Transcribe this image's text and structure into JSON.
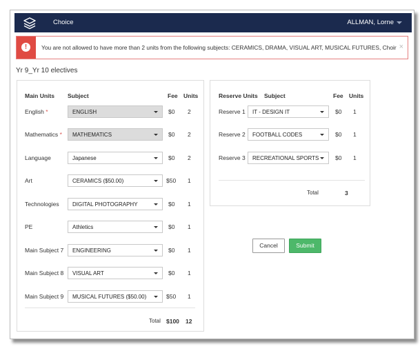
{
  "header": {
    "app_title": "Choice",
    "user_name": "ALLMAN, Lorne"
  },
  "alert": {
    "message": "You are not allowed to have more than 2 units from the following subjects: CERAMICS, DRAMA, VISUAL ART, MUSICAL FUTURES, Choir",
    "close": "×",
    "icon": "!"
  },
  "section_title": "Yr 9_Yr 10 electives",
  "main_units": {
    "headers": {
      "unit": "Main Units",
      "subject": "Subject",
      "fee": "Fee",
      "units": "Units"
    },
    "rows": [
      {
        "label": "English",
        "required": true,
        "subject": "ENGLISH",
        "disabled": true,
        "fee": "$0",
        "units": "2"
      },
      {
        "label": "Mathematics",
        "required": true,
        "subject": "MATHEMATICS",
        "disabled": true,
        "fee": "$0",
        "units": "2"
      },
      {
        "label": "Language",
        "required": false,
        "subject": "Japanese",
        "disabled": false,
        "fee": "$0",
        "units": "2"
      },
      {
        "label": "Art",
        "required": false,
        "subject": "CERAMICS ($50.00)",
        "disabled": false,
        "fee": "$50",
        "units": "1"
      },
      {
        "label": "Technologies",
        "required": false,
        "subject": "DIGITAL PHOTOGRAPHY",
        "disabled": false,
        "fee": "$0",
        "units": "1"
      },
      {
        "label": "PE",
        "required": false,
        "subject": "Athletics",
        "disabled": false,
        "fee": "$0",
        "units": "1"
      },
      {
        "label": "Main Subject 7",
        "required": false,
        "subject": "ENGINEERING",
        "disabled": false,
        "fee": "$0",
        "units": "1"
      },
      {
        "label": "Main Subject 8",
        "required": false,
        "subject": "VISUAL ART",
        "disabled": false,
        "fee": "$0",
        "units": "1"
      },
      {
        "label": "Main Subject 9",
        "required": false,
        "subject": "MUSICAL FUTURES ($50.00)",
        "disabled": false,
        "fee": "$50",
        "units": "1"
      }
    ],
    "total": {
      "label": "Total",
      "fee": "$100",
      "units": "12"
    }
  },
  "reserve_units": {
    "headers": {
      "unit": "Reserve Units",
      "subject": "Subject",
      "fee": "Fee",
      "units": "Units"
    },
    "rows": [
      {
        "label": "Reserve 1",
        "subject": "IT - DESIGN IT",
        "fee": "$0",
        "units": "1"
      },
      {
        "label": "Reserve 2",
        "subject": "FOOTBALL CODES",
        "fee": "$0",
        "units": "1"
      },
      {
        "label": "Reserve 3",
        "subject": "RECREATIONAL SPORTS",
        "fee": "$0",
        "units": "1"
      }
    ],
    "total": {
      "label": "Total",
      "units": "3"
    }
  },
  "actions": {
    "cancel": "Cancel",
    "submit": "Submit"
  },
  "colors": {
    "topbar": "#1b2a4e",
    "alert_border": "#e57f7f",
    "alert_icon": "#e04b43",
    "submit": "#4db86a",
    "required": "#d9534f"
  }
}
